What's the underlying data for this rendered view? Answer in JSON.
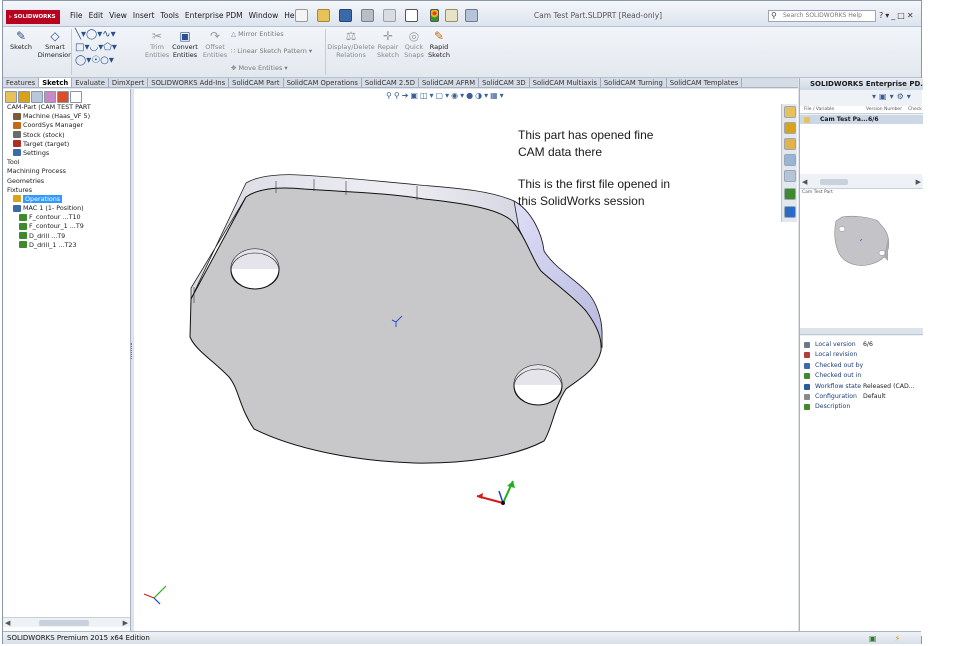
{
  "app": {
    "logo": "SOLIDWORKS",
    "document_title": "Cam Test Part.SLDPRT [Read-only]",
    "search_placeholder": "Search SOLIDWORKS Help",
    "menu": [
      "File",
      "Edit",
      "View",
      "Insert",
      "Tools",
      "Enterprise PDM",
      "Window",
      "Help"
    ]
  },
  "ribbon": {
    "sketch": "Sketch",
    "smart_dimension_1": "Smart",
    "smart_dimension_2": "Dimension",
    "trim_1": "Trim",
    "trim_2": "Entities",
    "convert_1": "Convert",
    "convert_2": "Entities",
    "offset_1": "Offset",
    "offset_2": "Entities",
    "mirror": "Mirror Entities",
    "linear_pattern": "Linear Sketch Pattern",
    "move": "Move Entities",
    "display_delete_1": "Display/Delete",
    "display_delete_2": "Relations",
    "repair_1": "Repair",
    "repair_2": "Sketch",
    "quick_snaps_1": "Quick",
    "quick_snaps_2": "Snaps",
    "rapid_1": "Rapid",
    "rapid_2": "Sketch"
  },
  "command_tabs": [
    "Features",
    "Sketch",
    "Evaluate",
    "DimXpert",
    "SOLIDWORKS Add-Ins",
    "SolidCAM Part",
    "SolidCAM Operations",
    "SolidCAM 2.5D",
    "SolidCAM AFRM",
    "SolidCAM 3D",
    "SolidCAM Multiaxis",
    "SolidCAM Turning",
    "SolidCAM Templates"
  ],
  "active_tab": "Sketch",
  "tree": [
    {
      "label": "CAM-Part (CAM TEST PART",
      "indent": 0,
      "color": ""
    },
    {
      "label": "Machine (Haas_VF 5)",
      "indent": 1,
      "color": "#7a5c3a"
    },
    {
      "label": "CoordSys Manager",
      "indent": 1,
      "color": "#c46a1a"
    },
    {
      "label": "Stock (stock)",
      "indent": 1,
      "color": "#6b6b6b"
    },
    {
      "label": "Target (target)",
      "indent": 1,
      "color": "#b0301f"
    },
    {
      "label": "Settings",
      "indent": 1,
      "color": "#3a6aa8"
    },
    {
      "label": "Tool",
      "indent": 0,
      "color": ""
    },
    {
      "label": "Machining Process",
      "indent": 0,
      "color": ""
    },
    {
      "label": "Geometries",
      "indent": 0,
      "color": ""
    },
    {
      "label": "Fixtures",
      "indent": 0,
      "color": ""
    },
    {
      "label": "Operations",
      "indent": 1,
      "color": "#d9a21b",
      "selected": true
    },
    {
      "label": "MAC 1 (1- Position)",
      "indent": 1,
      "color": "#3a6aa8"
    },
    {
      "label": "F_contour ...T10",
      "indent": 2,
      "color": "#3f8a2c"
    },
    {
      "label": "F_contour_1 ...T9",
      "indent": 2,
      "color": "#3f8a2c"
    },
    {
      "label": "D_drill ...T9",
      "indent": 2,
      "color": "#3f8a2c"
    },
    {
      "label": "D_drill_1 ...T23",
      "indent": 2,
      "color": "#3f8a2c"
    }
  ],
  "viewport": {
    "note_1a": "This part has opened fine",
    "note_1b": "CAM data there",
    "note_2a": "This is the first file opened in",
    "note_2b": "this SolidWorks session"
  },
  "pdm": {
    "title": "SOLIDWORKS Enterprise PD...",
    "col_file": "File / Variable",
    "col_version": "Version Number",
    "col_check": "Check",
    "file_row": "Cam Test Pa...",
    "file_version": "6/6",
    "preview_label": "Cam Test Part",
    "properties": [
      {
        "label": "Local version",
        "value": "6/6",
        "color": "#6a7a8c"
      },
      {
        "label": "Local revision",
        "value": "",
        "color": "#b04040"
      },
      {
        "label": "Checked out by",
        "value": "",
        "color": "#3a6aa8"
      },
      {
        "label": "Checked out in",
        "value": "",
        "color": "#3f8a2c"
      },
      {
        "label": "Workflow state",
        "value": "Released (CAD...",
        "color": "#2a5a9a"
      },
      {
        "label": "Configuration",
        "value": "Default",
        "color": "#8a8a8a"
      },
      {
        "label": "Description",
        "value": "",
        "color": "#3f8a2c"
      }
    ]
  },
  "status": {
    "text": "SOLIDWORKS Premium 2015 x64 Edition"
  }
}
